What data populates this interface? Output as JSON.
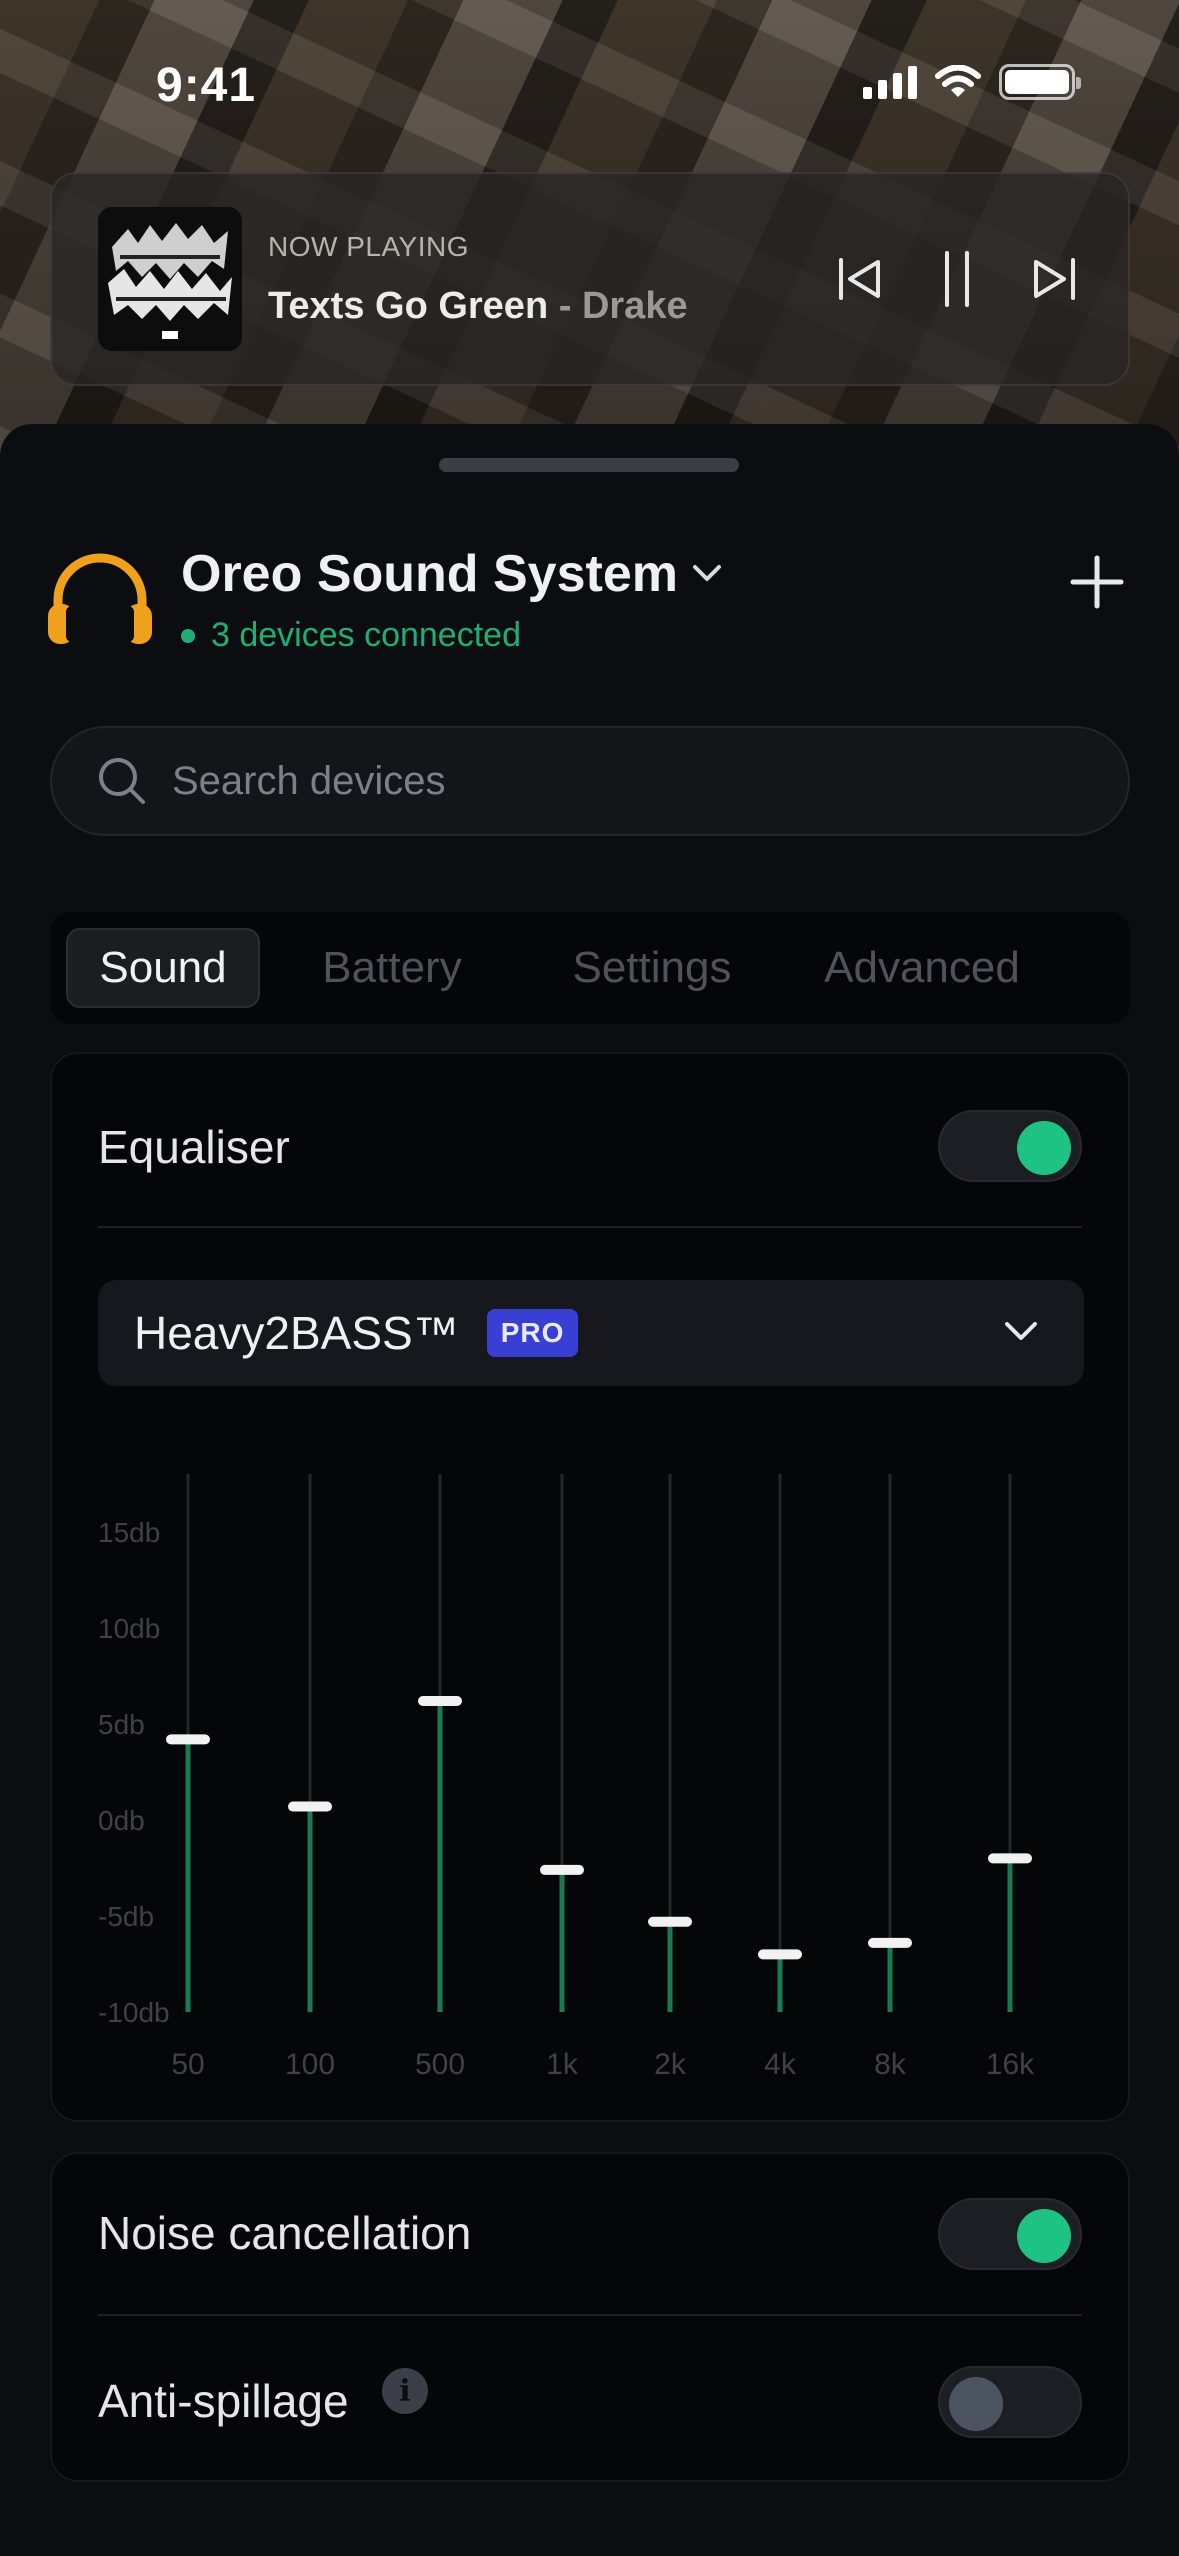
{
  "status_bar": {
    "time": "9:41"
  },
  "now_playing": {
    "label": "NOW PLAYING",
    "track": "Texts Go Green",
    "separator": " - ",
    "artist": "Drake"
  },
  "device": {
    "name": "Oreo Sound System",
    "status": "3 devices connected",
    "status_color": "#1fae75"
  },
  "search": {
    "placeholder": "Search devices",
    "value": ""
  },
  "tabs": [
    {
      "label": "Sound",
      "active": true
    },
    {
      "label": "Battery",
      "active": false
    },
    {
      "label": "Settings",
      "active": false
    },
    {
      "label": "Advanced",
      "active": false
    }
  ],
  "equaliser": {
    "label": "Equaliser",
    "enabled": true,
    "preset": "Heavy2BASS™",
    "preset_badge": "PRO"
  },
  "chart_data": {
    "type": "bar",
    "categories": [
      "50",
      "100",
      "500",
      "1k",
      "2k",
      "4k",
      "8k",
      "16k"
    ],
    "values": [
      4.2,
      0.7,
      6.2,
      -2.6,
      -5.3,
      -7.0,
      -6.4,
      -2.0
    ],
    "y_ticks": [
      "15db",
      "10db",
      "5db",
      "0db",
      "-5db",
      "-10db"
    ],
    "ylim": [
      -10,
      15
    ],
    "fill_color": "#1a7a52",
    "track_color": "#23262b"
  },
  "noise_cancellation": {
    "label": "Noise cancellation",
    "enabled": true
  },
  "anti_spillage": {
    "label": "Anti-spillage",
    "enabled": false,
    "info_glyph": "i"
  },
  "colors": {
    "accent": "#1ec283",
    "headphones": "#f0a11c",
    "badge": "#3a3fd4"
  }
}
